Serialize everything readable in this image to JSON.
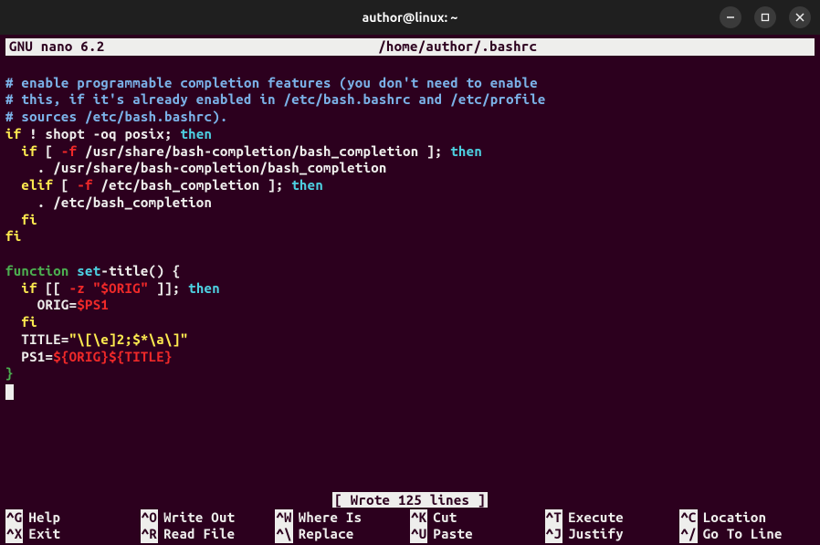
{
  "window": {
    "title": "author@linux: ~"
  },
  "nano": {
    "app": "GNU nano 6.2",
    "filepath": "/home/author/.bashrc"
  },
  "status": "[ Wrote 125 lines ]",
  "code": {
    "l1": "# enable programmable completion features (you don't need to enable",
    "l2": "# this, if it's already enabled in /etc/bash.bashrc and /etc/profile",
    "l3": "# sources /etc/bash.bashrc).",
    "l4a": "if",
    "l4b": " ! shopt -oq posix;",
    "l4c": " then",
    "l5a": "  if",
    "l5b": " [ ",
    "l5c": "-f",
    "l5d": " /usr/share/bash-completion/bash_completion ];",
    "l5e": " then",
    "l6": "    . /usr/share/bash-completion/bash_completion",
    "l7a": "  elif",
    "l7b": " [ ",
    "l7c": "-f",
    "l7d": " /etc/bash_completion ];",
    "l7e": " then",
    "l8": "    . /etc/bash_completion",
    "l9": "  fi",
    "l10": "fi",
    "l11a": "function",
    "l11b": " set",
    "l11c": "-title() {",
    "l12a": "  if",
    "l12b": " [[ ",
    "l12c": "-z \"$ORIG\"",
    "l12d": " ]];",
    "l12e": " then",
    "l13a": "    ORIG=",
    "l13b": "$PS1",
    "l14": "  fi",
    "l15a": "  TITLE=",
    "l15b": "\"\\[\\e]2;$*\\a\\]\"",
    "l16a": "  PS1=",
    "l16b": "${ORIG}${TITLE}",
    "l17": "}"
  },
  "shortcuts": [
    {
      "key": "^G",
      "label": "Help"
    },
    {
      "key": "^O",
      "label": "Write Out"
    },
    {
      "key": "^W",
      "label": "Where Is"
    },
    {
      "key": "^K",
      "label": "Cut"
    },
    {
      "key": "^T",
      "label": "Execute"
    },
    {
      "key": "^C",
      "label": "Location"
    },
    {
      "key": "^X",
      "label": "Exit"
    },
    {
      "key": "^R",
      "label": "Read File"
    },
    {
      "key": "^\\",
      "label": "Replace"
    },
    {
      "key": "^U",
      "label": "Paste"
    },
    {
      "key": "^J",
      "label": "Justify"
    },
    {
      "key": "^/",
      "label": "Go To Line"
    }
  ]
}
